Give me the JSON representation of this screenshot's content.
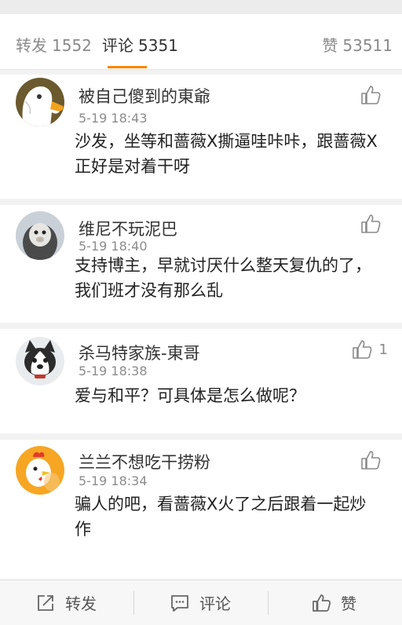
{
  "tabs": {
    "repost_label": "转发",
    "repost_count": "1552",
    "comment_label": "评论",
    "comment_count": "5351",
    "like_label": "赞",
    "like_count": "53511"
  },
  "comments": [
    {
      "username": "被自己傻到的東爺",
      "time": "5-19 18:43",
      "text": "沙发，坐等和蔷薇X撕逼哇咔咔，跟蔷薇X正好是对着干呀",
      "likes": "",
      "avatar_icon": "duck-avatar-icon"
    },
    {
      "username": "维尼不玩泥巴",
      "time": "5-19 18:40",
      "text": "支持博主，早就讨厌什么整天复仇的了，我们班才没有那么乱",
      "likes": "",
      "avatar_icon": "monkey-avatar-icon"
    },
    {
      "username": "杀马特家族-東哥",
      "time": "5-19 18:38",
      "text": "爱与和平？可具体是怎么做呢？",
      "likes": "1",
      "avatar_icon": "husky-avatar-icon"
    },
    {
      "username": "兰兰不想吃干捞粉",
      "time": "5-19 18:34",
      "text": "骗人的吧，看蔷薇X火了之后跟着一起炒作",
      "likes": "",
      "avatar_icon": "rooster-avatar-icon"
    }
  ],
  "bottombar": {
    "repost_label": "转发",
    "comment_label": "评论",
    "like_label": "赞"
  },
  "colors": {
    "accent": "#ff8200",
    "text": "#222222",
    "muted": "#8c8c8c"
  }
}
